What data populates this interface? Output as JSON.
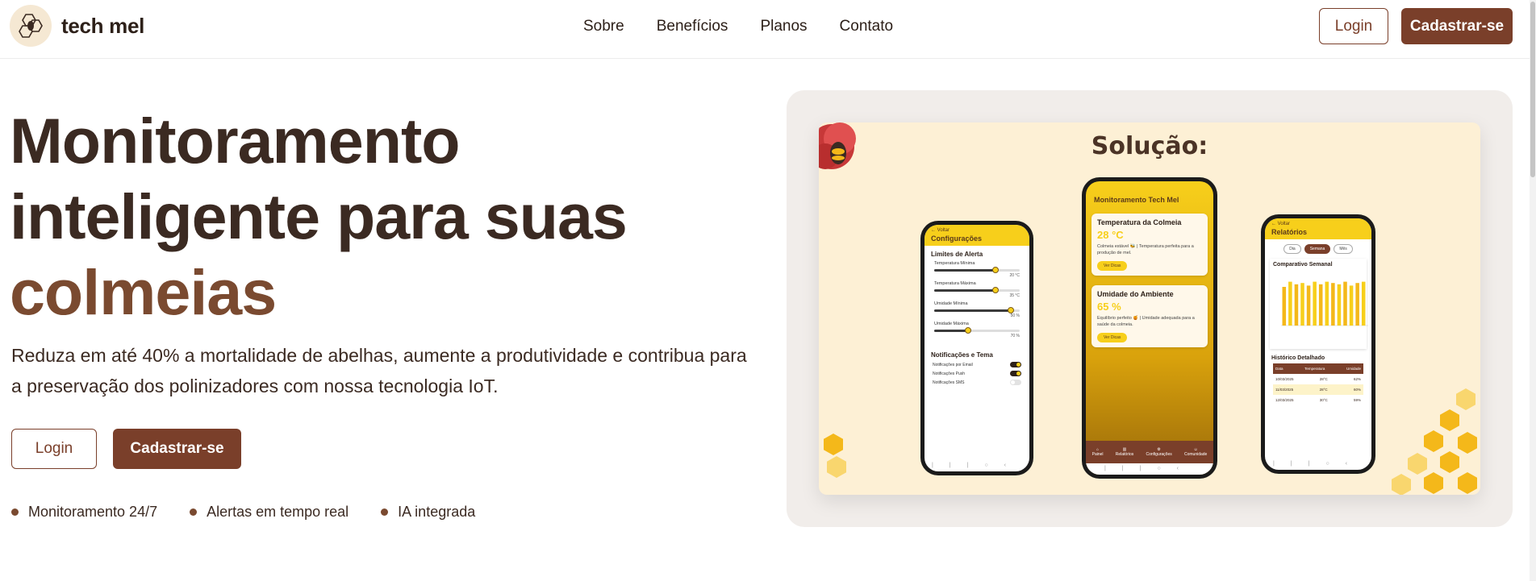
{
  "header": {
    "brand": "tech mel",
    "nav": [
      "Sobre",
      "Benefícios",
      "Planos",
      "Contato"
    ],
    "login_label": "Login",
    "signup_label": "Cadastrar-se"
  },
  "hero": {
    "title_line1": "Monitoramento",
    "title_line2": "inteligente para suas",
    "title_accent": "colmeias",
    "subtitle": "Reduza em até 40% a mortalidade de abelhas, aumente a produtividade e contribua para a preservação dos polinizadores com nossa tecnologia IoT.",
    "login_label": "Login",
    "signup_label": "Cadastrar-se",
    "features": [
      "Monitoramento 24/7",
      "Alertas em tempo real",
      "IA integrada"
    ]
  },
  "showcase": {
    "title": "Solução:",
    "phone_left": {
      "back": "← Voltar",
      "title": "Configurações",
      "section_alerts": "Limites de Alerta",
      "sliders": [
        {
          "label": "Temperatura Mínima",
          "value": "20 °C",
          "level": 0.72
        },
        {
          "label": "Temperatura Máxima",
          "value": "35 °C",
          "level": 0.72
        },
        {
          "label": "Umidade Mínima",
          "value": "50 %",
          "level": 0.9
        },
        {
          "label": "Umidade Máxima",
          "value": "70 %",
          "level": 0.4
        }
      ],
      "section_notify": "Notificações e Tema",
      "toggles": [
        {
          "label": "Notificações por Email",
          "on": true
        },
        {
          "label": "Notificações Push",
          "on": true
        },
        {
          "label": "Notificações SMS",
          "on": false
        }
      ]
    },
    "phone_center": {
      "title": "Monitoramento Tech Mel",
      "temp_title": "Temperatura da Colmeia",
      "temp_value": "28 °C",
      "temp_text": "Colmeia estável 🐝 | Temperatura perfeita para a produção de mel.",
      "temp_button": "Ver Dicas",
      "hum_title": "Umidade do Ambiente",
      "hum_value": "65 %",
      "hum_text": "Equilíbrio perfeito 🍯 | Umidade adequada para a saúde da colmeia.",
      "hum_button": "Ver Dicas",
      "tabs": [
        "Painel",
        "Relatórios",
        "Configurações",
        "Comunidade"
      ]
    },
    "phone_right": {
      "back": "← Voltar",
      "title": "Relatórios",
      "chips": [
        "Dia",
        "Semana",
        "Mês"
      ],
      "chart_title": "Comparativo Semanal",
      "history_title": "Histórico Detalhado",
      "table_head": [
        "Data",
        "Temperatura",
        "Umidade"
      ],
      "table_rows": [
        [
          "10/03/2025",
          "28°C",
          "62%"
        ],
        [
          "11/03/2025",
          "28°C",
          "60%"
        ],
        [
          "12/03/2025",
          "30°C",
          "59%"
        ]
      ]
    }
  },
  "chart_data": {
    "type": "bar",
    "categories": [
      "",
      "",
      "",
      "",
      "",
      "",
      "",
      "",
      "",
      "",
      "",
      "",
      "",
      ""
    ],
    "series": [
      {
        "values": [
          30,
          34,
          32,
          33,
          31,
          34,
          32,
          34,
          33,
          32,
          34,
          31,
          33,
          34
        ]
      }
    ],
    "ylim": [
      0,
      40
    ]
  },
  "colors": {
    "brand_brown": "#7a3f2a",
    "honey_yellow": "#f7cf1b",
    "text_dark": "#3b2a22"
  }
}
